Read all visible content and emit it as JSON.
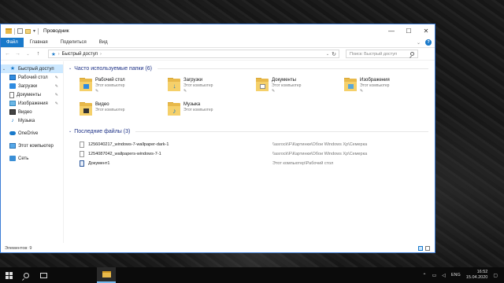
{
  "window": {
    "title": "Проводник",
    "controls": {
      "minimize": "—",
      "maximize": "☐",
      "close": "✕"
    }
  },
  "ribbon": {
    "tabs": [
      "Файл",
      "Главная",
      "Поделиться",
      "Вид"
    ],
    "help": "?"
  },
  "address": {
    "path": "Быстрый доступ",
    "search_placeholder": "Поиск: Быстрый доступ"
  },
  "nav": {
    "items": [
      {
        "label": "Быстрый доступ",
        "pinned": false
      },
      {
        "label": "Рабочий стол",
        "pinned": true
      },
      {
        "label": "Загрузки",
        "pinned": true
      },
      {
        "label": "Документы",
        "pinned": true
      },
      {
        "label": "Изображения",
        "pinned": true
      },
      {
        "label": "Видео",
        "pinned": false
      },
      {
        "label": "Музыка",
        "pinned": false
      },
      {
        "label": "OneDrive",
        "pinned": false
      },
      {
        "label": "Этот компьютер",
        "pinned": false
      },
      {
        "label": "Сеть",
        "pinned": false
      }
    ]
  },
  "frequent": {
    "title": "Часто используемые папки (6)",
    "folders": [
      {
        "name": "Рабочий стол",
        "location": "Этот компьютер",
        "icon": "desktop-folder-icon"
      },
      {
        "name": "Загрузки",
        "location": "Этот компьютер",
        "icon": "downloads-folder-icon"
      },
      {
        "name": "Документы",
        "location": "Этот компьютер",
        "icon": "documents-folder-icon"
      },
      {
        "name": "Изображения",
        "location": "Этот компьютер",
        "icon": "pictures-folder-icon"
      },
      {
        "name": "Видео",
        "location": "Этот компьютер",
        "icon": "videos-folder-icon"
      },
      {
        "name": "Музыка",
        "location": "Этот компьютер",
        "icon": "music-folder-icon"
      }
    ]
  },
  "recent": {
    "title": "Последние файлы (3)",
    "files": [
      {
        "name": "1256040217_windows-7-wallpaper-dark-1",
        "path": "\\\\asrock\\F\\Картинки\\Обои Windows Xp\\Семерка"
      },
      {
        "name": "1254087042_wallpapers-windows-7-1",
        "path": "\\\\asrock\\F\\Картинки\\Обои Windows Xp\\Семерка"
      },
      {
        "name": "Документ1",
        "path": "Этот компьютер\\Рабочий стол"
      }
    ]
  },
  "status": {
    "items": "Элементов: 9"
  },
  "taskbar": {
    "lang": "ENG",
    "time": "16:52",
    "date": "15.04.2020"
  }
}
